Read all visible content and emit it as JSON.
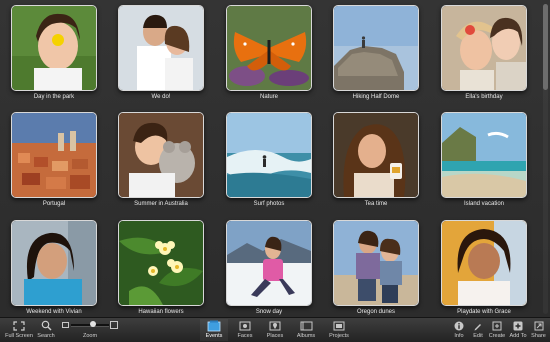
{
  "events": [
    {
      "title": "Day in the park"
    },
    {
      "title": "We do!"
    },
    {
      "title": "Nature"
    },
    {
      "title": "Hiking Half Dome"
    },
    {
      "title": "Ella's birthday"
    },
    {
      "title": "Portugal"
    },
    {
      "title": "Summer in Australia"
    },
    {
      "title": "Surf photos"
    },
    {
      "title": "Tea time"
    },
    {
      "title": "Island vacation"
    },
    {
      "title": "Weekend with Vivian"
    },
    {
      "title": "Hawaiian flowers"
    },
    {
      "title": "Snow day"
    },
    {
      "title": "Oregon dunes"
    },
    {
      "title": "Playdate with Grace"
    }
  ],
  "toolbar": {
    "full_screen": "Full Screen",
    "search": "Search",
    "zoom": "Zoom",
    "zoom_level": 0.6,
    "events": "Events",
    "faces": "Faces",
    "places": "Places",
    "albums": "Albums",
    "projects": "Projects",
    "info": "Info",
    "edit": "Edit",
    "create": "Create",
    "add_to": "Add To",
    "share": "Share"
  }
}
